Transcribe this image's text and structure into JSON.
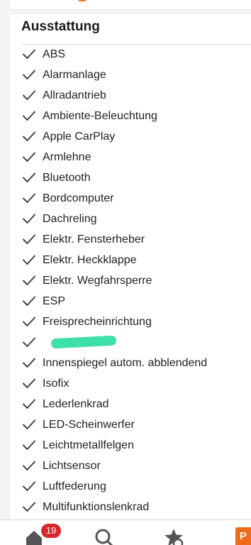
{
  "section": {
    "title": "Ausstattung"
  },
  "features": [
    {
      "label": "ABS"
    },
    {
      "label": "Alarmanlage"
    },
    {
      "label": "Allradantrieb"
    },
    {
      "label": "Ambiente-Beleuchtung"
    },
    {
      "label": "Apple CarPlay"
    },
    {
      "label": "Armlehne"
    },
    {
      "label": "Bluetooth"
    },
    {
      "label": "Bordcomputer"
    },
    {
      "label": "Dachreling"
    },
    {
      "label": "Elektr. Fensterheber"
    },
    {
      "label": "Elektr. Heckklappe"
    },
    {
      "label": "Elektr. Wegfahrsperre"
    },
    {
      "label": "ESP"
    },
    {
      "label": "Freisprecheinrichtung"
    },
    {
      "label": ""
    },
    {
      "label": "Innenspiegel autom. abblendend"
    },
    {
      "label": "Isofix"
    },
    {
      "label": "Lederlenkrad"
    },
    {
      "label": "LED-Scheinwerfer"
    },
    {
      "label": "Leichtmetallfelgen"
    },
    {
      "label": "Lichtsensor"
    },
    {
      "label": "Luftfederung"
    },
    {
      "label": "Multifunktionslenkrad"
    }
  ],
  "nav": {
    "home_badge": "19",
    "profile_label": "P"
  },
  "icons": {
    "check": "check-icon",
    "home": "home-icon",
    "search": "search-icon",
    "favorites": "star-gear-icon"
  },
  "colors": {
    "accent": "#ef6b1a",
    "badge": "#d8262e",
    "redaction": "#3de0a8",
    "check": "#444444"
  }
}
